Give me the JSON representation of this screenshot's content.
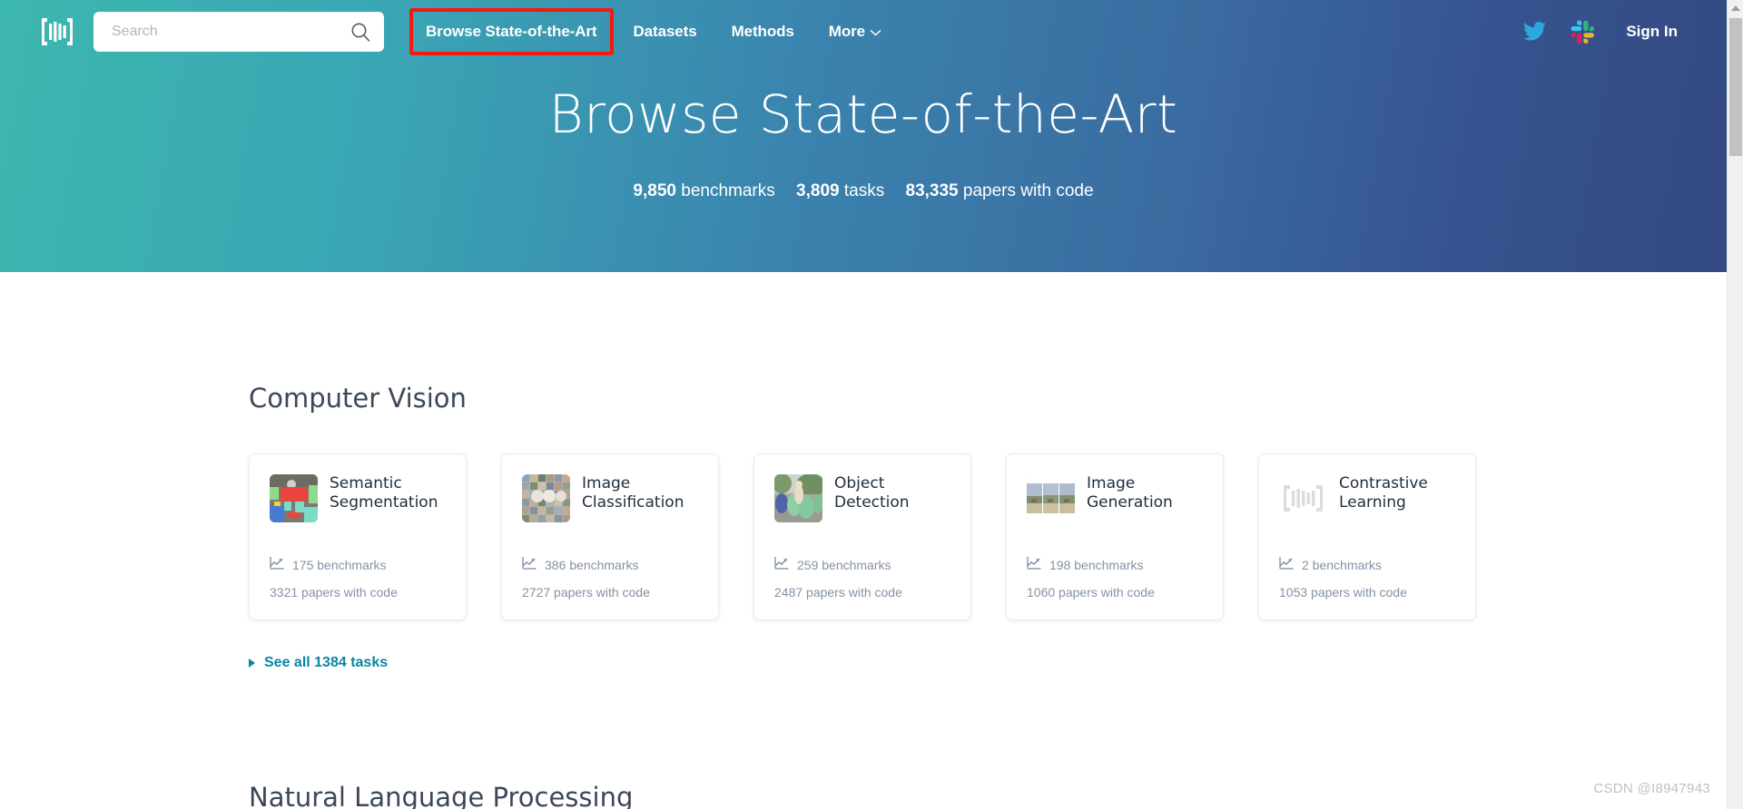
{
  "header": {
    "logo_icon": "paperswithcode-brackets-logo",
    "search": {
      "placeholder": "Search",
      "value": "",
      "icon": "search-icon"
    },
    "nav": [
      {
        "label": "Browse State-of-the-Art",
        "highlighted": true
      },
      {
        "label": "Datasets",
        "highlighted": false
      },
      {
        "label": "Methods",
        "highlighted": false
      },
      {
        "label": "More",
        "highlighted": false,
        "caret": "⌄"
      }
    ],
    "twitter_icon": "twitter-bird-icon",
    "slack_icon": "slack-icon",
    "sign_in": "Sign In",
    "highlight_color": "#f41a11"
  },
  "hero": {
    "title": "Browse State-of-the-Art",
    "stats": [
      {
        "number": "9,850",
        "label": "benchmarks"
      },
      {
        "number": "3,809",
        "label": "tasks"
      },
      {
        "number": "83,335",
        "label": "papers with code"
      }
    ],
    "gradient_from": "#3cb7ae",
    "gradient_to": "#344a82"
  },
  "sections": [
    {
      "title": "Computer Vision",
      "cards": [
        {
          "title": "Semantic Segmentation",
          "benchmarks": "175 benchmarks",
          "papers": "3321 papers with code",
          "thumb": "semantic-segmentation-thumbnail"
        },
        {
          "title": "Image Classification",
          "benchmarks": "386 benchmarks",
          "papers": "2727 papers with code",
          "thumb": "image-classification-thumbnail"
        },
        {
          "title": "Object Detection",
          "benchmarks": "259 benchmarks",
          "papers": "2487 papers with code",
          "thumb": "object-detection-thumbnail"
        },
        {
          "title": "Image Generation",
          "benchmarks": "198 benchmarks",
          "papers": "1060 papers with code",
          "thumb": "image-generation-thumbnail"
        },
        {
          "title": "Contrastive Learning",
          "benchmarks": "2 benchmarks",
          "papers": "1053 papers with code",
          "thumb": "contrastive-learning-thumbnail"
        }
      ],
      "see_all": "See all 1384 tasks"
    },
    {
      "title": "Natural Language Processing",
      "cards": [],
      "see_all": ""
    }
  ],
  "watermark": "CSDN @I8947943"
}
